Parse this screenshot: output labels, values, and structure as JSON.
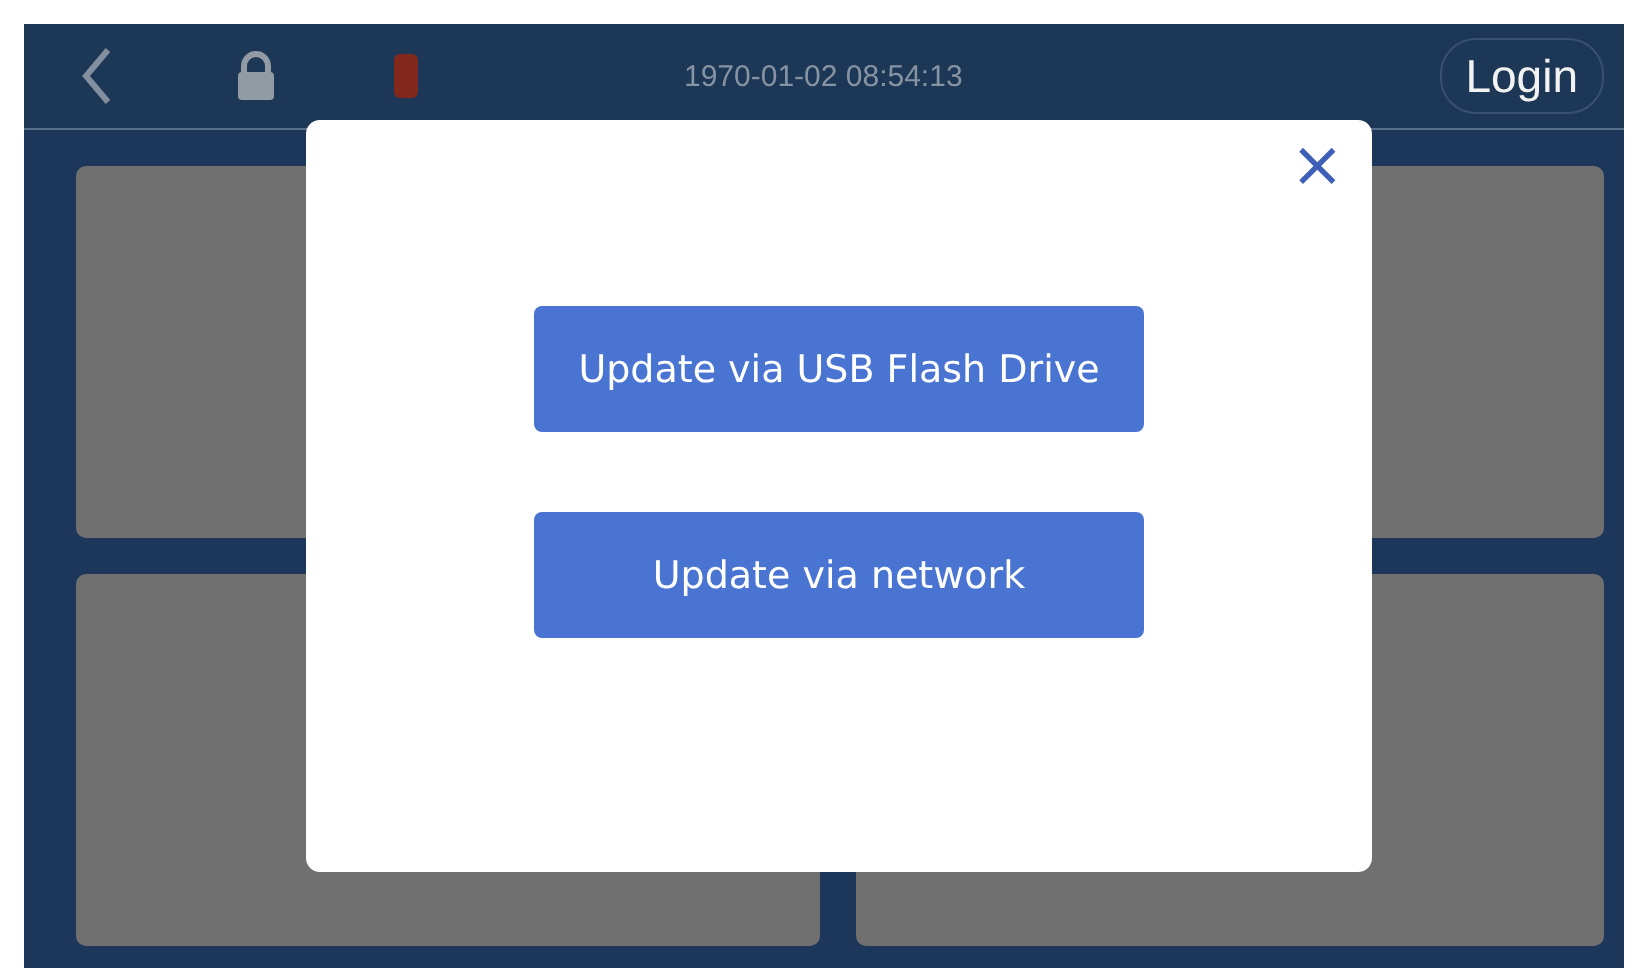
{
  "top_bar": {
    "datetime": "1970-01-02 08:54:13",
    "login_button": "Login"
  },
  "dialog": {
    "close": "×",
    "buttons": [
      "Update via USB Flash Drive",
      "Update via network"
    ]
  }
}
